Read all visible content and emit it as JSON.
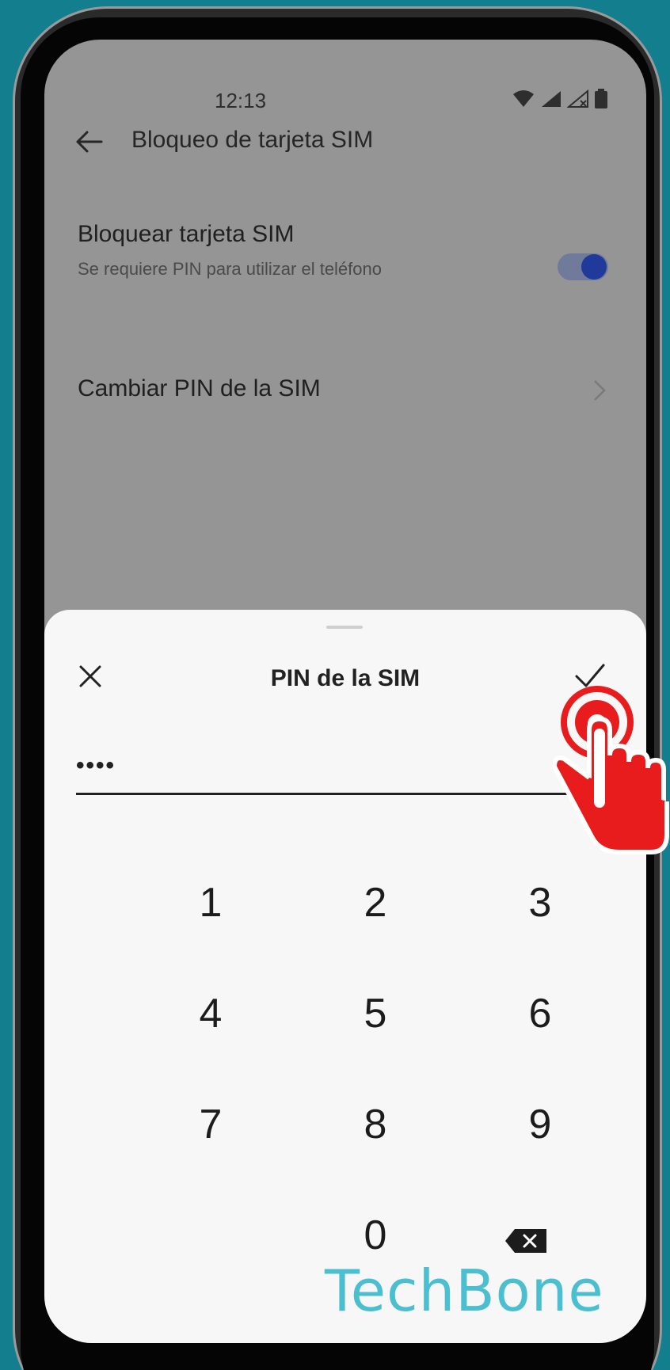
{
  "status_bar": {
    "time": "12:13"
  },
  "app_bar": {
    "title": "Bloqueo de tarjeta SIM"
  },
  "settings": {
    "lock_sim": {
      "title": "Bloquear tarjeta SIM",
      "subtitle": "Se requiere PIN para utilizar el teléfono",
      "enabled": true
    },
    "change_pin": {
      "title": "Cambiar PIN de la SIM"
    }
  },
  "dialog": {
    "title": "PIN de la SIM",
    "pin_value": "••••",
    "keys": [
      "1",
      "2",
      "3",
      "4",
      "5",
      "6",
      "7",
      "8",
      "9",
      "0"
    ]
  },
  "watermark": "TechBone",
  "colors": {
    "accent": "#1f3a9a",
    "tap_hand": "#e81c1c",
    "background": "#127e8e"
  },
  "icons": [
    "back-arrow-icon",
    "close-icon",
    "check-icon",
    "chevron-right-icon",
    "backspace-icon",
    "wifi-icon",
    "signal-icon",
    "battery-icon",
    "tap-hand-icon"
  ]
}
